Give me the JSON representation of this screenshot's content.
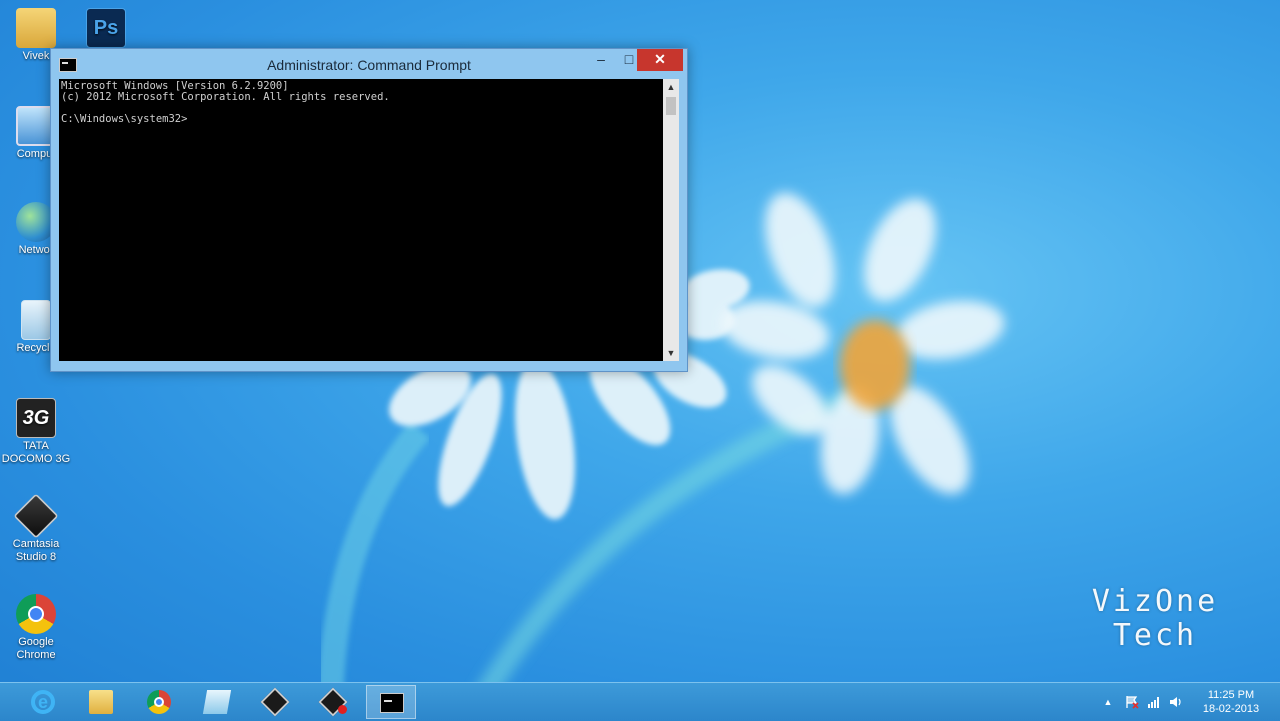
{
  "desktop": {
    "icons": [
      {
        "label": "Vivek"
      },
      {
        "label": "Comput"
      },
      {
        "label": "Networ"
      },
      {
        "label": "Recycle"
      },
      {
        "label": "TATA\nDOCOMO 3G",
        "badge": "3G"
      },
      {
        "label": "Camtasia\nStudio 8"
      },
      {
        "label": "Google\nChrome"
      }
    ],
    "ps_badge": "Ps"
  },
  "window": {
    "title": "Administrator: Command Prompt",
    "min_glyph": "–",
    "max_glyph": "□",
    "close_glyph": "✕",
    "console_lines": [
      "Microsoft Windows [Version 6.2.9200]",
      "(c) 2012 Microsoft Corporation. All rights reserved.",
      "",
      "C:\\Windows\\system32>"
    ]
  },
  "watermark": {
    "line1": "VizOne",
    "line2": "Tech"
  },
  "taskbar": {
    "tray_chevron": "▲",
    "clock": {
      "time": "11:25 PM",
      "date": "18-02-2013"
    }
  },
  "colors": {
    "accent": "#2a8fdf",
    "close": "#c7362d",
    "taskbar": "#2c86cb"
  }
}
